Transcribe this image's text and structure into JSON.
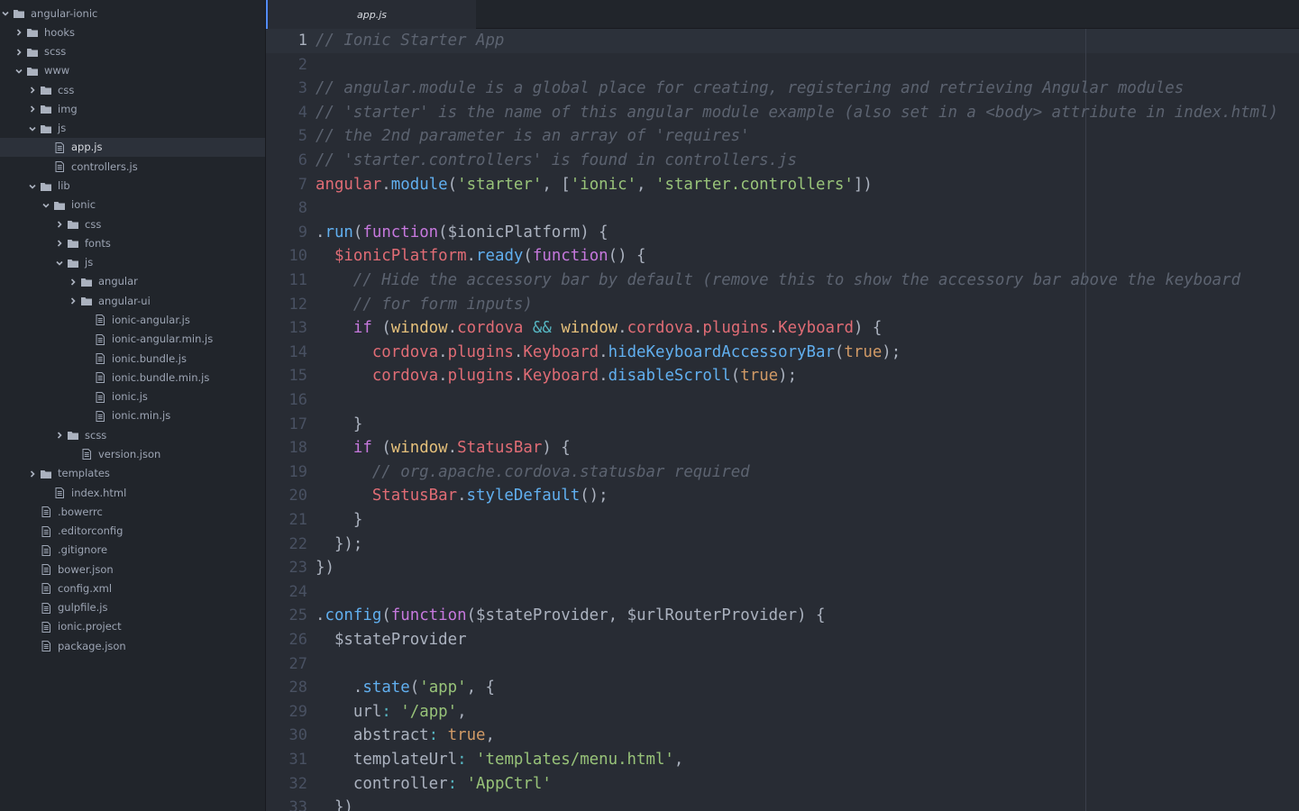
{
  "colors": {
    "sidebar_bg": "#21252b",
    "editor_bg": "#282c34",
    "selection": "#2c313a",
    "accent": "#528bff",
    "folder_icon": "#abb2bf"
  },
  "tree": {
    "items": [
      {
        "label": "angular-ionic",
        "type": "folder",
        "depth": 0,
        "expanded": true
      },
      {
        "label": "hooks",
        "type": "folder",
        "depth": 1,
        "expanded": false
      },
      {
        "label": "scss",
        "type": "folder",
        "depth": 1,
        "expanded": false
      },
      {
        "label": "www",
        "type": "folder",
        "depth": 1,
        "expanded": true
      },
      {
        "label": "css",
        "type": "folder",
        "depth": 2,
        "expanded": false
      },
      {
        "label": "img",
        "type": "folder",
        "depth": 2,
        "expanded": false
      },
      {
        "label": "js",
        "type": "folder",
        "depth": 2,
        "expanded": true
      },
      {
        "label": "app.js",
        "type": "file",
        "depth": 3,
        "selected": true
      },
      {
        "label": "controllers.js",
        "type": "file",
        "depth": 3
      },
      {
        "label": "lib",
        "type": "folder",
        "depth": 2,
        "expanded": true
      },
      {
        "label": "ionic",
        "type": "folder",
        "depth": 3,
        "expanded": true
      },
      {
        "label": "css",
        "type": "folder",
        "depth": 4,
        "expanded": false
      },
      {
        "label": "fonts",
        "type": "folder",
        "depth": 4,
        "expanded": false
      },
      {
        "label": "js",
        "type": "folder",
        "depth": 4,
        "expanded": true
      },
      {
        "label": "angular",
        "type": "folder",
        "depth": 5,
        "expanded": false
      },
      {
        "label": "angular-ui",
        "type": "folder",
        "depth": 5,
        "expanded": false
      },
      {
        "label": "ionic-angular.js",
        "type": "file",
        "depth": 6
      },
      {
        "label": "ionic-angular.min.js",
        "type": "file",
        "depth": 6
      },
      {
        "label": "ionic.bundle.js",
        "type": "file",
        "depth": 6
      },
      {
        "label": "ionic.bundle.min.js",
        "type": "file",
        "depth": 6
      },
      {
        "label": "ionic.js",
        "type": "file",
        "depth": 6
      },
      {
        "label": "ionic.min.js",
        "type": "file",
        "depth": 6
      },
      {
        "label": "scss",
        "type": "folder",
        "depth": 4,
        "expanded": false
      },
      {
        "label": "version.json",
        "type": "file",
        "depth": 5
      },
      {
        "label": "templates",
        "type": "folder",
        "depth": 2,
        "expanded": false
      },
      {
        "label": "index.html",
        "type": "file",
        "depth": 3
      },
      {
        "label": ".bowerrc",
        "type": "file",
        "depth": 2
      },
      {
        "label": ".editorconfig",
        "type": "file",
        "depth": 2
      },
      {
        "label": ".gitignore",
        "type": "file",
        "depth": 2
      },
      {
        "label": "bower.json",
        "type": "file",
        "depth": 2
      },
      {
        "label": "config.xml",
        "type": "file",
        "depth": 2
      },
      {
        "label": "gulpfile.js",
        "type": "file",
        "depth": 2
      },
      {
        "label": "ionic.project",
        "type": "file",
        "depth": 2
      },
      {
        "label": "package.json",
        "type": "file",
        "depth": 2
      }
    ]
  },
  "tabs": [
    {
      "label": "app.js",
      "active": true
    }
  ],
  "editor": {
    "current_line": 1,
    "lines": [
      {
        "n": "1",
        "indent": 0,
        "tokens": [
          [
            "comment",
            "// Ionic Starter App"
          ]
        ]
      },
      {
        "n": "2",
        "indent": 0,
        "tokens": []
      },
      {
        "n": "3",
        "indent": 0,
        "tokens": [
          [
            "comment",
            "// angular.module is a global place for creating, registering and retrieving Angular modules"
          ]
        ]
      },
      {
        "n": "4",
        "indent": 0,
        "tokens": [
          [
            "comment",
            "// 'starter' is the name of this angular module example (also set in a <body> attribute in index.html)"
          ]
        ]
      },
      {
        "n": "5",
        "indent": 0,
        "tokens": [
          [
            "comment",
            "// the 2nd parameter is an array of 'requires'"
          ]
        ]
      },
      {
        "n": "6",
        "indent": 0,
        "tokens": [
          [
            "comment",
            "// 'starter.controllers' is found in controllers.js"
          ]
        ]
      },
      {
        "n": "7",
        "indent": 0,
        "tokens": [
          [
            "var",
            "angular"
          ],
          [
            "punct",
            "."
          ],
          [
            "func",
            "module"
          ],
          [
            "punct",
            "("
          ],
          [
            "string",
            "'starter'"
          ],
          [
            "punct",
            ", ["
          ],
          [
            "string",
            "'ionic'"
          ],
          [
            "punct",
            ", "
          ],
          [
            "string",
            "'starter.controllers'"
          ],
          [
            "punct",
            "])"
          ]
        ]
      },
      {
        "n": "8",
        "indent": 0,
        "tokens": []
      },
      {
        "n": "9",
        "indent": 0,
        "tokens": [
          [
            "punct",
            "."
          ],
          [
            "func",
            "run"
          ],
          [
            "punct",
            "("
          ],
          [
            "keyword",
            "function"
          ],
          [
            "punct",
            "("
          ],
          [
            "plain",
            "$ionicPlatform"
          ],
          [
            "punct",
            ") {"
          ]
        ]
      },
      {
        "n": "10",
        "indent": 2,
        "tokens": [
          [
            "var",
            "$ionicPlatform"
          ],
          [
            "punct",
            "."
          ],
          [
            "func",
            "ready"
          ],
          [
            "punct",
            "("
          ],
          [
            "keyword",
            "function"
          ],
          [
            "punct",
            "() {"
          ]
        ]
      },
      {
        "n": "11",
        "indent": 4,
        "tokens": [
          [
            "comment",
            "// Hide the accessory bar by default (remove this to show the accessory bar above the keyboard"
          ]
        ]
      },
      {
        "n": "12",
        "indent": 4,
        "tokens": [
          [
            "comment",
            "// for form inputs)"
          ]
        ]
      },
      {
        "n": "13",
        "indent": 4,
        "tokens": [
          [
            "keyword",
            "if"
          ],
          [
            "punct",
            " ("
          ],
          [
            "obj",
            "window"
          ],
          [
            "punct",
            "."
          ],
          [
            "var",
            "cordova"
          ],
          [
            "punct",
            " "
          ],
          [
            "op",
            "&&"
          ],
          [
            "punct",
            " "
          ],
          [
            "obj",
            "window"
          ],
          [
            "punct",
            "."
          ],
          [
            "var",
            "cordova"
          ],
          [
            "punct",
            "."
          ],
          [
            "var",
            "plugins"
          ],
          [
            "punct",
            "."
          ],
          [
            "var",
            "Keyboard"
          ],
          [
            "punct",
            ") {"
          ]
        ]
      },
      {
        "n": "14",
        "indent": 6,
        "tokens": [
          [
            "var",
            "cordova"
          ],
          [
            "punct",
            "."
          ],
          [
            "var",
            "plugins"
          ],
          [
            "punct",
            "."
          ],
          [
            "var",
            "Keyboard"
          ],
          [
            "punct",
            "."
          ],
          [
            "func",
            "hideKeyboardAccessoryBar"
          ],
          [
            "punct",
            "("
          ],
          [
            "const",
            "true"
          ],
          [
            "punct",
            ");"
          ]
        ]
      },
      {
        "n": "15",
        "indent": 6,
        "tokens": [
          [
            "var",
            "cordova"
          ],
          [
            "punct",
            "."
          ],
          [
            "var",
            "plugins"
          ],
          [
            "punct",
            "."
          ],
          [
            "var",
            "Keyboard"
          ],
          [
            "punct",
            "."
          ],
          [
            "func",
            "disableScroll"
          ],
          [
            "punct",
            "("
          ],
          [
            "const",
            "true"
          ],
          [
            "punct",
            ");"
          ]
        ]
      },
      {
        "n": "16",
        "indent": 0,
        "tokens": []
      },
      {
        "n": "17",
        "indent": 4,
        "tokens": [
          [
            "punct",
            "}"
          ]
        ]
      },
      {
        "n": "18",
        "indent": 4,
        "tokens": [
          [
            "keyword",
            "if"
          ],
          [
            "punct",
            " ("
          ],
          [
            "obj",
            "window"
          ],
          [
            "punct",
            "."
          ],
          [
            "var",
            "StatusBar"
          ],
          [
            "punct",
            ") {"
          ]
        ]
      },
      {
        "n": "19",
        "indent": 6,
        "tokens": [
          [
            "comment",
            "// org.apache.cordova.statusbar required"
          ]
        ]
      },
      {
        "n": "20",
        "indent": 6,
        "tokens": [
          [
            "var",
            "StatusBar"
          ],
          [
            "punct",
            "."
          ],
          [
            "func",
            "styleDefault"
          ],
          [
            "punct",
            "();"
          ]
        ]
      },
      {
        "n": "21",
        "indent": 4,
        "tokens": [
          [
            "punct",
            "}"
          ]
        ]
      },
      {
        "n": "22",
        "indent": 2,
        "tokens": [
          [
            "punct",
            "});"
          ]
        ]
      },
      {
        "n": "23",
        "indent": 0,
        "tokens": [
          [
            "punct",
            "})"
          ]
        ]
      },
      {
        "n": "24",
        "indent": 0,
        "tokens": []
      },
      {
        "n": "25",
        "indent": 0,
        "tokens": [
          [
            "punct",
            "."
          ],
          [
            "func",
            "config"
          ],
          [
            "punct",
            "("
          ],
          [
            "keyword",
            "function"
          ],
          [
            "punct",
            "("
          ],
          [
            "plain",
            "$stateProvider"
          ],
          [
            "punct",
            ", "
          ],
          [
            "plain",
            "$urlRouterProvider"
          ],
          [
            "punct",
            ") {"
          ]
        ]
      },
      {
        "n": "26",
        "indent": 2,
        "tokens": [
          [
            "plain",
            "$stateProvider"
          ]
        ]
      },
      {
        "n": "27",
        "indent": 0,
        "tokens": []
      },
      {
        "n": "28",
        "indent": 4,
        "tokens": [
          [
            "punct",
            "."
          ],
          [
            "func",
            "state"
          ],
          [
            "punct",
            "("
          ],
          [
            "string",
            "'app'"
          ],
          [
            "punct",
            ", {"
          ]
        ]
      },
      {
        "n": "29",
        "indent": 4,
        "tokens": [
          [
            "plain",
            "url"
          ],
          [
            "op",
            ":"
          ],
          [
            "punct",
            " "
          ],
          [
            "string",
            "'/app'"
          ],
          [
            "punct",
            ","
          ]
        ]
      },
      {
        "n": "30",
        "indent": 4,
        "tokens": [
          [
            "plain",
            "abstract"
          ],
          [
            "op",
            ":"
          ],
          [
            "punct",
            " "
          ],
          [
            "const",
            "true"
          ],
          [
            "punct",
            ","
          ]
        ]
      },
      {
        "n": "31",
        "indent": 4,
        "tokens": [
          [
            "plain",
            "templateUrl"
          ],
          [
            "op",
            ":"
          ],
          [
            "punct",
            " "
          ],
          [
            "string",
            "'templates/menu.html'"
          ],
          [
            "punct",
            ","
          ]
        ]
      },
      {
        "n": "32",
        "indent": 4,
        "tokens": [
          [
            "plain",
            "controller"
          ],
          [
            "op",
            ":"
          ],
          [
            "punct",
            " "
          ],
          [
            "string",
            "'AppCtrl'"
          ]
        ]
      },
      {
        "n": "33",
        "indent": 2,
        "tokens": [
          [
            "punct",
            "})"
          ]
        ]
      }
    ]
  }
}
